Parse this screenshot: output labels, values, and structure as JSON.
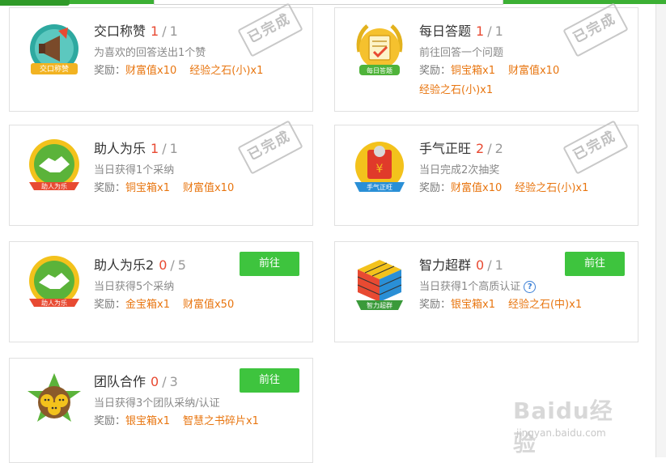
{
  "stamp_label": "已完成",
  "go_label": "前往",
  "watermark": {
    "brand": "Baidu经验",
    "url": "jingyan.baidu.com"
  },
  "tasks": [
    {
      "title": "交口称赞",
      "current": "1",
      "sep": "/",
      "total": "1",
      "desc": "为喜欢的回答送出1个赞",
      "reward_label": "奖励：",
      "rewards": [
        "财富值x10",
        "经验之石(小)x1"
      ],
      "badge_text": "交口称赞",
      "status": "done"
    },
    {
      "title": "每日答题",
      "current": "1",
      "sep": "/",
      "total": "1",
      "desc": "前往回答一个问题",
      "reward_label": "奖励：",
      "rewards": [
        "铜宝箱x1",
        "财富值x10",
        "经验之石(小)x1"
      ],
      "badge_text": "每日答题",
      "status": "done"
    },
    {
      "title": "助人为乐",
      "current": "1",
      "sep": "/",
      "total": "1",
      "desc": "当日获得1个采纳",
      "reward_label": "奖励：",
      "rewards": [
        "铜宝箱x1",
        "财富值x10"
      ],
      "badge_text": "助人为乐",
      "status": "done"
    },
    {
      "title": "手气正旺",
      "current": "2",
      "sep": "/",
      "total": "2",
      "desc": "当日完成2次抽奖",
      "reward_label": "奖励：",
      "rewards": [
        "财富值x10",
        "经验之石(小)x1"
      ],
      "badge_text": "手气正旺",
      "status": "done"
    },
    {
      "title": "助人为乐2",
      "current": "0",
      "sep": "/",
      "total": "5",
      "desc": "当日获得5个采纳",
      "reward_label": "奖励：",
      "rewards": [
        "金宝箱x1",
        "财富值x50"
      ],
      "badge_text": "助人为乐",
      "status": "todo"
    },
    {
      "title": "智力超群",
      "current": "0",
      "sep": "/",
      "total": "1",
      "desc": "当日获得1个高质认证",
      "help": "?",
      "reward_label": "奖励：",
      "rewards": [
        "银宝箱x1",
        "经验之石(中)x1"
      ],
      "badge_text": "智力超群",
      "status": "todo"
    },
    {
      "title": "团队合作",
      "current": "0",
      "sep": "/",
      "total": "3",
      "desc": "当日获得3个团队采纳/认证",
      "reward_label": "奖励：",
      "rewards": [
        "银宝箱x1",
        "智慧之书碎片x1"
      ],
      "status": "todo"
    }
  ]
}
